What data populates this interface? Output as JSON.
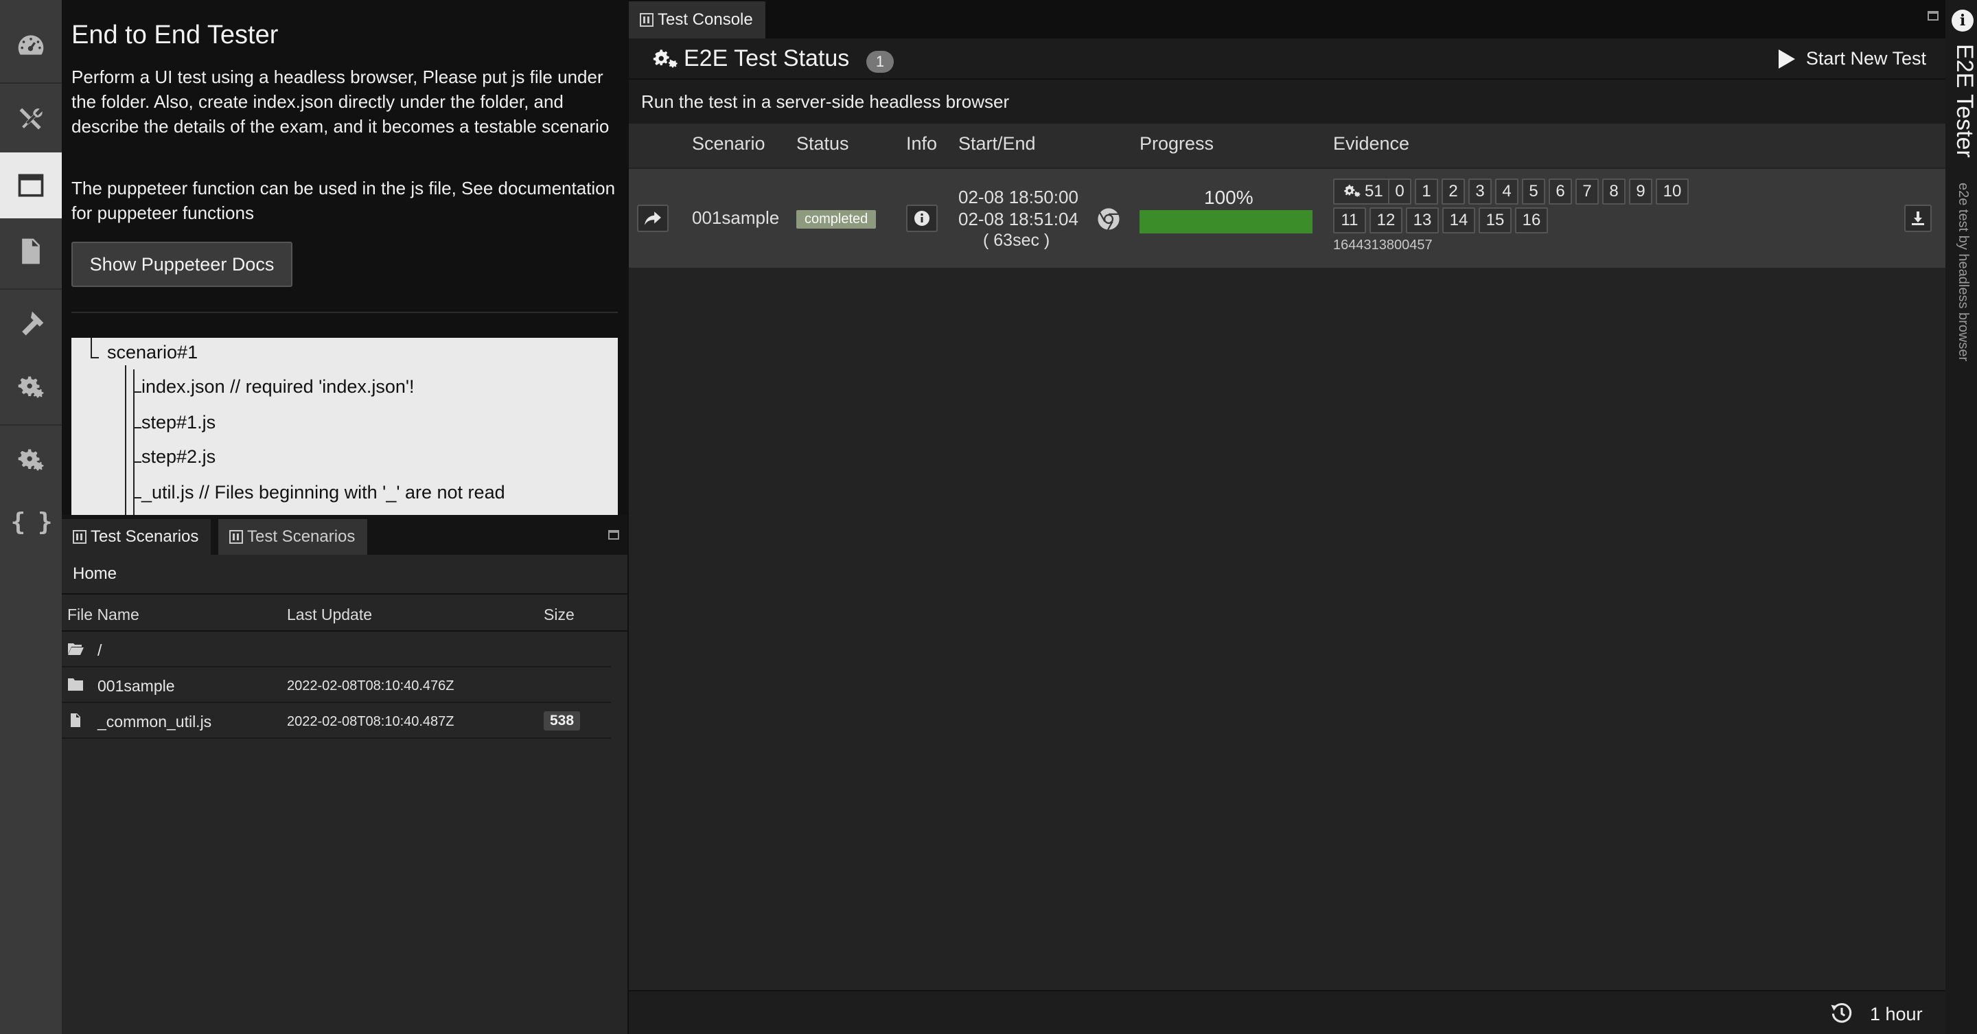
{
  "app": {
    "title": "End to End Tester"
  },
  "rail": {
    "items": [
      "dashboard-icon",
      "tools-icon",
      "browser-window-icon",
      "file-icon",
      "hammer-icon",
      "gears-icon",
      "gears-icon",
      "braces-icon"
    ],
    "active_index": 2,
    "braces_glyph": "{ }"
  },
  "info": {
    "title": "End to End Tester",
    "desc1": "Perform a UI test using a headless browser, Please put js file under the folder. Also, create index.json directly under the folder, and describe the details of the exam, and it becomes a testable scenario",
    "desc2": "The puppeteer function can be used in the js file, See documentation for puppeteer functions",
    "docs_button": "Show Puppeteer Docs",
    "tree": [
      "scenario#1",
      "index.json // required 'index.json'!",
      "step#1.js",
      "step#2.js",
      "_util.js // Files beginning with '_' are not read"
    ]
  },
  "scenarios": {
    "tabs": [
      "Test Scenarios",
      "Test Scenarios"
    ],
    "breadcrumb": "Home",
    "columns": [
      "File Name",
      "Last Update",
      "Size"
    ],
    "rows": [
      {
        "icon": "folder-open-icon",
        "name": "/",
        "updated": "",
        "size": ""
      },
      {
        "icon": "folder-icon",
        "name": "001sample",
        "updated": "2022-02-08T08:10:40.476Z",
        "size": ""
      },
      {
        "icon": "file-icon",
        "name": "_common_util.js",
        "updated": "2022-02-08T08:10:40.487Z",
        "size": "538"
      }
    ]
  },
  "console": {
    "tab": "Test Console",
    "status_title": "E2E Test Status",
    "status_count": "1",
    "start_button": "Start New Test",
    "subtitle": "Run the test in a server-side headless browser",
    "columns": [
      "Scenario",
      "Status",
      "Info",
      "Start/End",
      "Progress",
      "Evidence"
    ],
    "row": {
      "scenario": "001sample",
      "status": "completed",
      "start": "02-08 18:50:00",
      "end": "02-08 18:51:04",
      "duration": "( 63sec )",
      "browser_icon": "chrome-icon",
      "progress_label": "100%",
      "progress": 1.0,
      "evidence_count": "51",
      "evidence_steps": [
        "0",
        "1",
        "2",
        "3",
        "4",
        "5",
        "6",
        "7",
        "8",
        "9",
        "10",
        "11",
        "12",
        "13",
        "14",
        "15",
        "16"
      ],
      "evidence_id": "1644313800457"
    },
    "footer": {
      "refresh_label": "1 hour"
    }
  },
  "side": {
    "title": "E2E Tester",
    "subtitle": "e2e test by headless browser"
  },
  "colors": {
    "accent_green": "#3b8d2a",
    "completed_badge": "#8d9a7e"
  }
}
